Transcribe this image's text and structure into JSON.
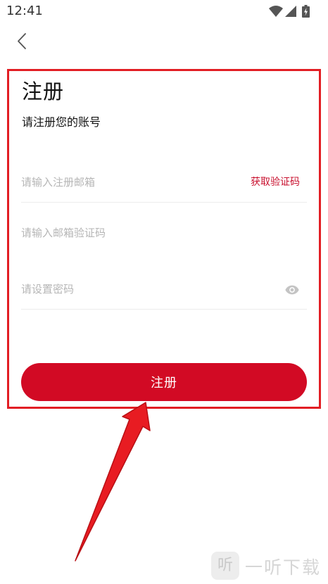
{
  "status_bar": {
    "time": "12:41"
  },
  "header": {
    "back_icon": "chevron-left-icon"
  },
  "register": {
    "title": "注册",
    "subtitle": "请注册您的账号",
    "email": {
      "value": "",
      "placeholder": "请输入注册邮箱"
    },
    "get_code_label": "获取验证码",
    "code": {
      "value": "",
      "placeholder": "请输入邮箱验证码"
    },
    "password": {
      "value": "",
      "placeholder": "请设置密码"
    },
    "password_toggle_icon": "eye-icon",
    "submit_label": "注册"
  },
  "watermark": {
    "logo_glyph": "听",
    "text": "一听下载"
  },
  "colors": {
    "accent": "#d20a24",
    "link": "#c8102e",
    "annotation": "#e21e24",
    "placeholder": "#b6b6b6"
  }
}
